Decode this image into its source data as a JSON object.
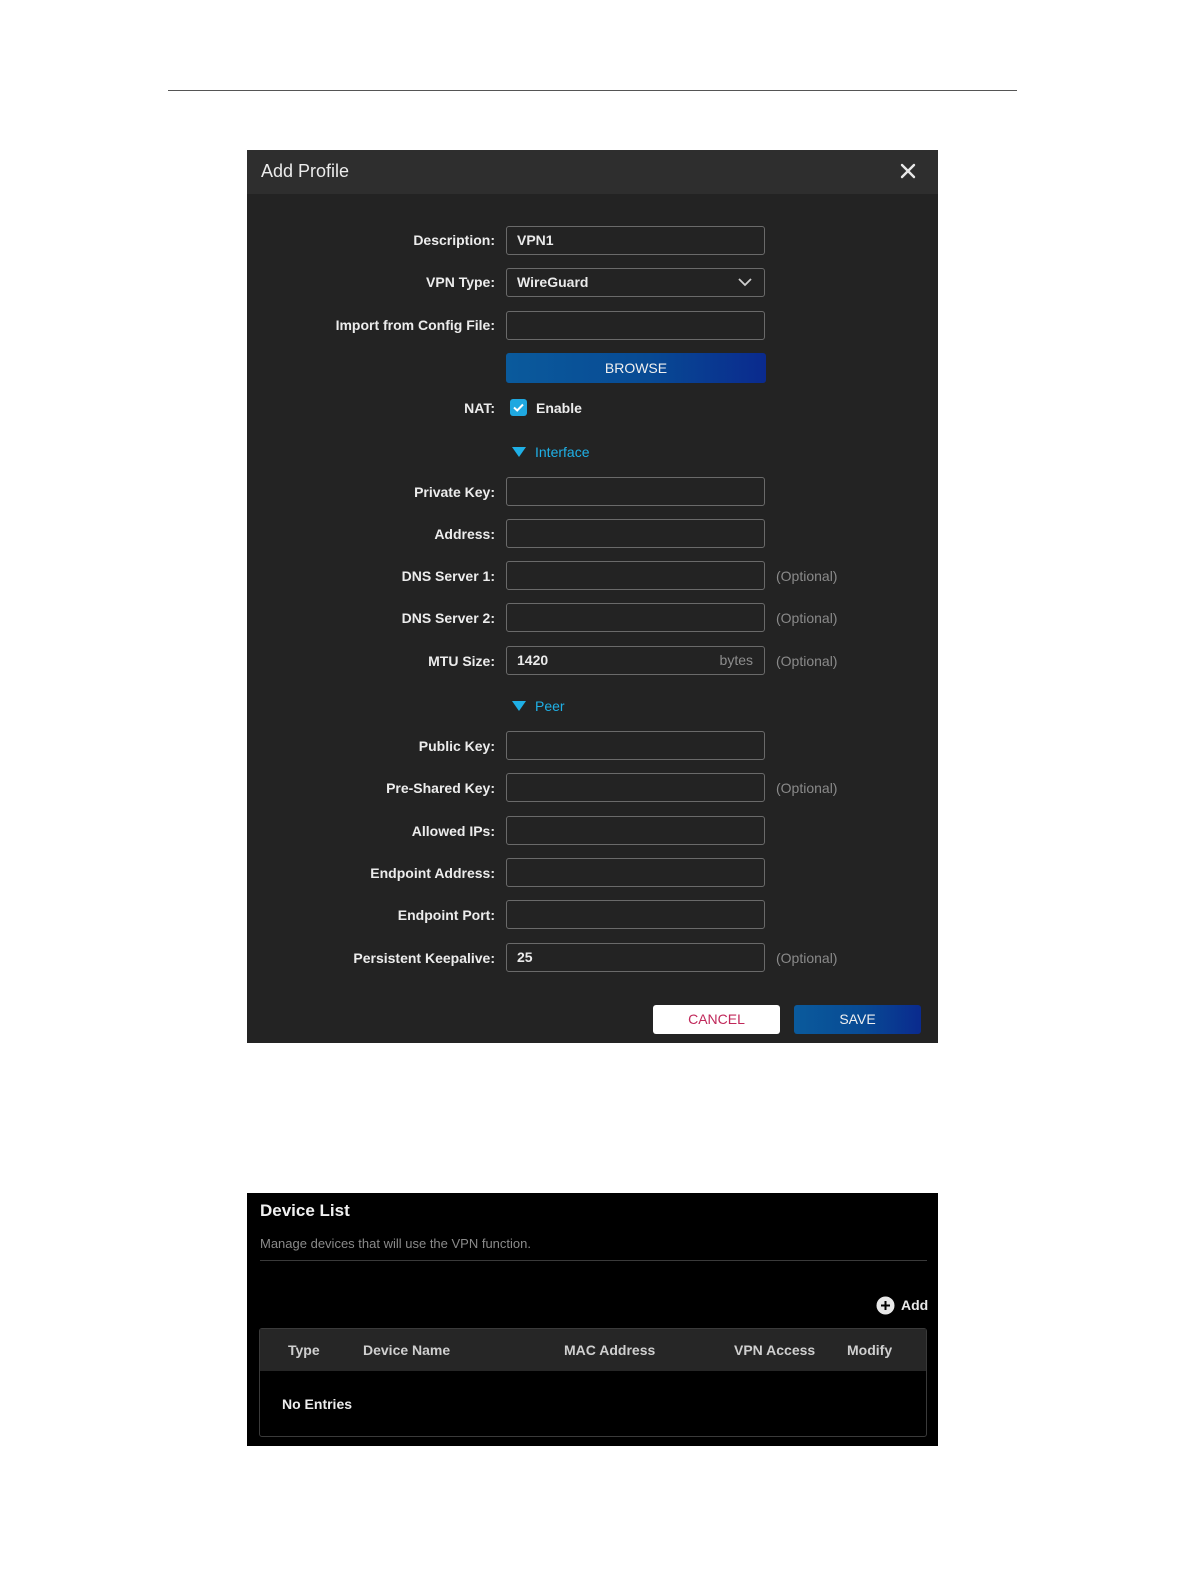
{
  "dialog": {
    "title": "Add Profile",
    "fields": {
      "description": {
        "label": "Description:",
        "value": "VPN1"
      },
      "vpn_type": {
        "label": "VPN Type:",
        "value": "WireGuard"
      },
      "import_config": {
        "label": "Import from Config File:",
        "value": ""
      },
      "browse_label": "BROWSE",
      "nat": {
        "label": "NAT:",
        "checkbox_label": "Enable",
        "checked": true
      },
      "interface_section": "Interface",
      "private_key": {
        "label": "Private Key:",
        "value": ""
      },
      "address": {
        "label": "Address:",
        "value": ""
      },
      "dns1": {
        "label": "DNS Server 1:",
        "value": "",
        "hint": "(Optional)"
      },
      "dns2": {
        "label": "DNS Server 2:",
        "value": "",
        "hint": "(Optional)"
      },
      "mtu": {
        "label": "MTU Size:",
        "value": "1420",
        "unit": "bytes",
        "hint": "(Optional)"
      },
      "peer_section": "Peer",
      "public_key": {
        "label": "Public Key:",
        "value": ""
      },
      "preshared_key": {
        "label": "Pre-Shared Key:",
        "value": "",
        "hint": "(Optional)"
      },
      "allowed_ips": {
        "label": "Allowed IPs:",
        "value": ""
      },
      "endpoint_address": {
        "label": "Endpoint Address:",
        "value": ""
      },
      "endpoint_port": {
        "label": "Endpoint Port:",
        "value": ""
      },
      "keepalive": {
        "label": "Persistent Keepalive:",
        "value": "25",
        "hint": "(Optional)"
      }
    },
    "cancel_label": "CANCEL",
    "save_label": "SAVE"
  },
  "device_list": {
    "title": "Device List",
    "subtitle": "Manage devices that will use the VPN function.",
    "add_label": "Add",
    "columns": [
      "Type",
      "Device Name",
      "MAC Address",
      "VPN Access",
      "Modify"
    ],
    "empty_text": "No Entries"
  },
  "colors": {
    "accent": "#1fb0e6",
    "button_blue": "#084a94",
    "cancel_text": "#c0285a"
  }
}
